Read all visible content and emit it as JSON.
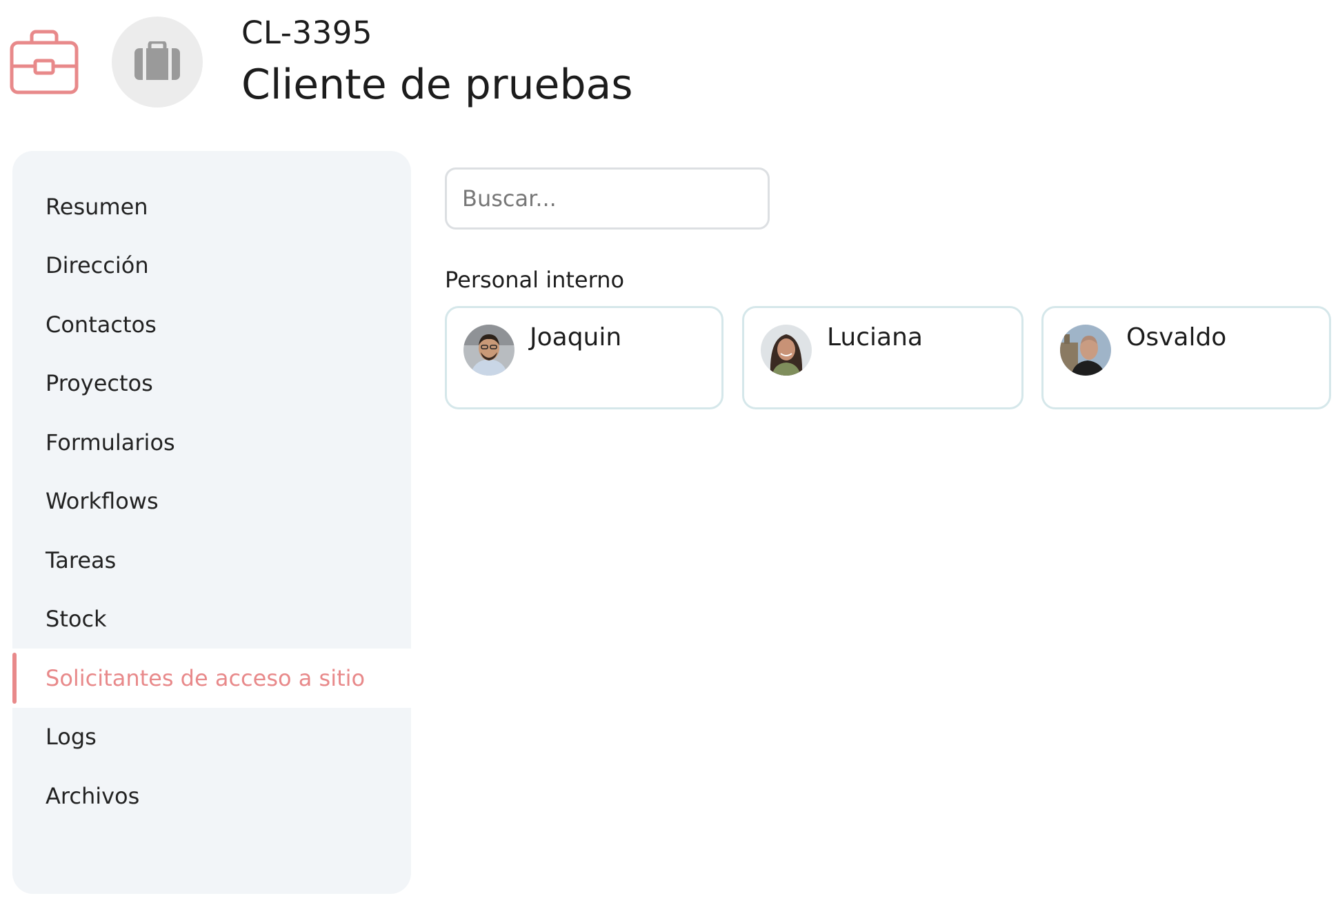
{
  "header": {
    "icon": "briefcase-icon",
    "avatar_icon": "suitcase-icon",
    "client_code": "CL-3395",
    "client_name": "Cliente de pruebas"
  },
  "sidebar": {
    "items": [
      {
        "label": "Resumen",
        "active": false
      },
      {
        "label": "Dirección",
        "active": false
      },
      {
        "label": "Contactos",
        "active": false
      },
      {
        "label": "Proyectos",
        "active": false
      },
      {
        "label": "Formularios",
        "active": false
      },
      {
        "label": "Workflows",
        "active": false
      },
      {
        "label": "Tareas",
        "active": false
      },
      {
        "label": "Stock",
        "active": false
      },
      {
        "label": "Solicitantes de acceso a sitio",
        "active": true
      },
      {
        "label": "Logs",
        "active": false
      },
      {
        "label": "Archivos",
        "active": false
      }
    ]
  },
  "search": {
    "placeholder": "Buscar...",
    "value": ""
  },
  "section": {
    "title": "Personal interno"
  },
  "people": [
    {
      "name": "Joaquin"
    },
    {
      "name": "Luciana"
    },
    {
      "name": "Osvaldo"
    }
  ],
  "colors": {
    "accent": "#e8898a",
    "sidebar_bg": "#f2f5f8",
    "card_border": "#d5e7ea"
  }
}
